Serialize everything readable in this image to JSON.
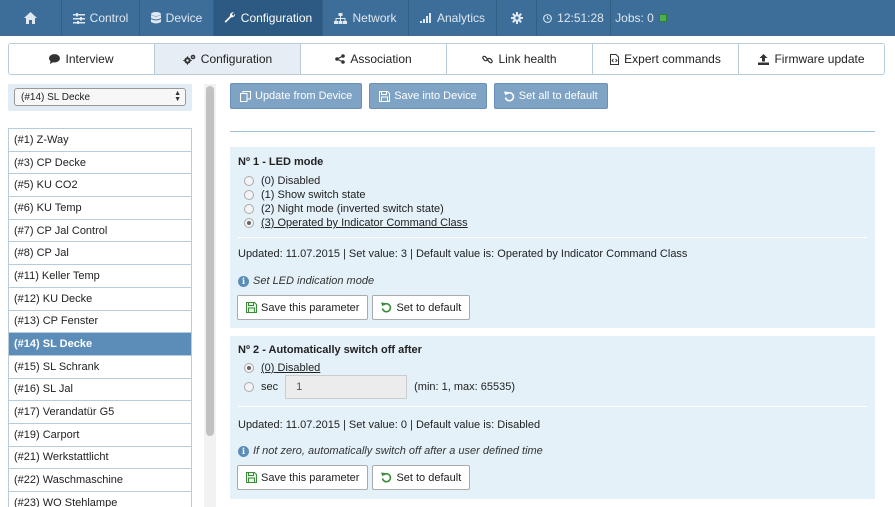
{
  "nav": {
    "time": "12:51:28",
    "jobs": "Jobs: 0",
    "items": [
      {
        "label": "Control"
      },
      {
        "label": "Device"
      },
      {
        "label": "Configuration"
      },
      {
        "label": "Network"
      },
      {
        "label": "Analytics"
      }
    ]
  },
  "tabs": [
    {
      "label": "Interview"
    },
    {
      "label": "Configuration"
    },
    {
      "label": "Association"
    },
    {
      "label": "Link health"
    },
    {
      "label": "Expert commands"
    },
    {
      "label": "Firmware update"
    }
  ],
  "device_select": {
    "value": "(#14) SL Decke"
  },
  "devices": [
    "(#1) Z-Way",
    "(#3) CP Decke",
    "(#5) KU CO2",
    "(#6) KU Temp",
    "(#7) CP Jal Control",
    "(#8) CP Jal",
    "(#11) Keller Temp",
    "(#12) KU Decke",
    "(#13) CP Fenster",
    "(#14) SL Decke",
    "(#15) SL Schrank",
    "(#16) SL Jal",
    "(#17) Verandatür G5",
    "(#19) Carport",
    "(#21) Werkstattlicht",
    "(#22) Waschmaschine",
    "(#23) WO Stehlampe"
  ],
  "toolbar": {
    "update": "Update from Device",
    "save": "Save into Device",
    "reset": "Set all to default"
  },
  "param1": {
    "title": "Nº 1 - LED mode",
    "options": [
      "(0) Disabled",
      "(1) Show switch state",
      "(2) Night mode (inverted switch state)",
      "(3) Operated by Indicator Command Class"
    ],
    "updated": "Updated: 11.07.2015 | Set value: 3 | Default value is: Operated by Indicator Command Class",
    "hint": "Set LED indication mode",
    "save_label": "Save this parameter",
    "default_label": "Set to default"
  },
  "param2": {
    "title": "Nº 2 - Automatically switch off after",
    "opt_disabled": "(0) Disabled",
    "opt_sec": "sec",
    "sec_value": "1",
    "range": "(min: 1, max: 65535)",
    "updated": "Updated: 11.07.2015 | Set value: 0 | Default value is: Disabled",
    "hint": "If not zero, automatically switch off after a user defined time",
    "save_label": "Save this parameter",
    "default_label": "Set to default"
  }
}
